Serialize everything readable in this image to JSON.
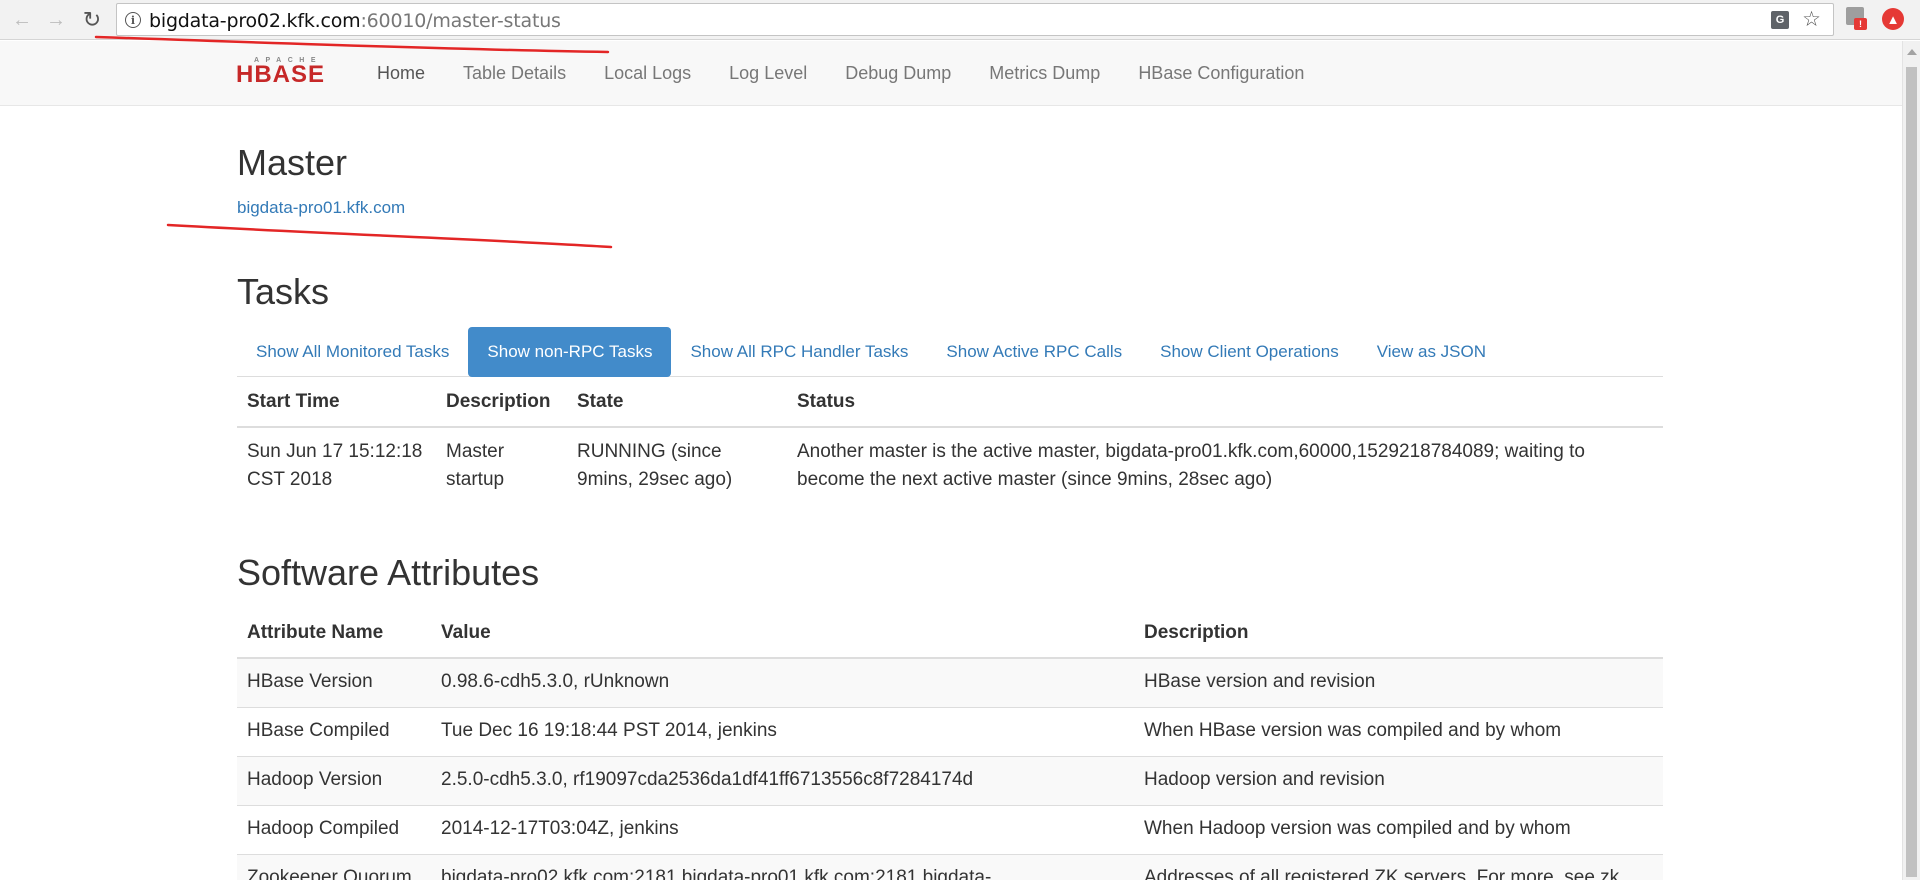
{
  "browser": {
    "url_host": "bigdata-pro02.kfk.com",
    "url_rest": ":60010/master-status",
    "back_icon": "arrow-left-icon",
    "forward_icon": "arrow-right-icon",
    "reload_icon": "reload-icon",
    "info_icon": "info-icon",
    "translate_icon": "translate-icon",
    "star_icon": "star-icon",
    "extension_badge": "!"
  },
  "navbar": {
    "logo_sub": "APACHE",
    "logo_main": "HBASE",
    "links": [
      {
        "label": "Home"
      },
      {
        "label": "Table Details"
      },
      {
        "label": "Local Logs"
      },
      {
        "label": "Log Level"
      },
      {
        "label": "Debug Dump"
      },
      {
        "label": "Metrics Dump"
      },
      {
        "label": "HBase Configuration"
      }
    ]
  },
  "master": {
    "title": "Master",
    "host": "bigdata-pro01.kfk.com"
  },
  "tasks": {
    "title": "Tasks",
    "tabs": [
      {
        "label": "Show All Monitored Tasks"
      },
      {
        "label": "Show non-RPC Tasks"
      },
      {
        "label": "Show All RPC Handler Tasks"
      },
      {
        "label": "Show Active RPC Calls"
      },
      {
        "label": "Show Client Operations"
      },
      {
        "label": "View as JSON"
      }
    ],
    "active_tab": 1,
    "columns": [
      "Start Time",
      "Description",
      "State",
      "Status"
    ],
    "rows": [
      {
        "start_time": "Sun Jun 17 15:12:18 CST 2018",
        "description": "Master startup",
        "state": "RUNNING (since 9mins, 29sec ago)",
        "status": "Another master is the active master, bigdata-pro01.kfk.com,60000,1529218784089; waiting to become the next active master (since 9mins, 28sec ago)"
      }
    ]
  },
  "software": {
    "title": "Software Attributes",
    "columns": [
      "Attribute Name",
      "Value",
      "Description"
    ],
    "rows": [
      {
        "name": "HBase Version",
        "value": "0.98.6-cdh5.3.0, rUnknown",
        "description": "HBase version and revision"
      },
      {
        "name": "HBase Compiled",
        "value": "Tue Dec 16 19:18:44 PST 2014, jenkins",
        "description": "When HBase version was compiled and by whom"
      },
      {
        "name": "Hadoop Version",
        "value": "2.5.0-cdh5.3.0, rf19097cda2536da1df41ff6713556c8f7284174d",
        "description": "Hadoop version and revision"
      },
      {
        "name": "Hadoop Compiled",
        "value": "2014-12-17T03:04Z, jenkins",
        "description": "When Hadoop version was compiled and by whom"
      },
      {
        "name": "Zookeeper Quorum",
        "value": "bigdata-pro02.kfk.com:2181,bigdata-pro01.kfk.com:2181,bigdata-",
        "description": "Addresses of all registered ZK servers. For more, see zk"
      }
    ]
  },
  "colors": {
    "link": "#337ab7",
    "active_tab": "#428bca",
    "annotation": "#e32626",
    "logo": "#c62828"
  }
}
